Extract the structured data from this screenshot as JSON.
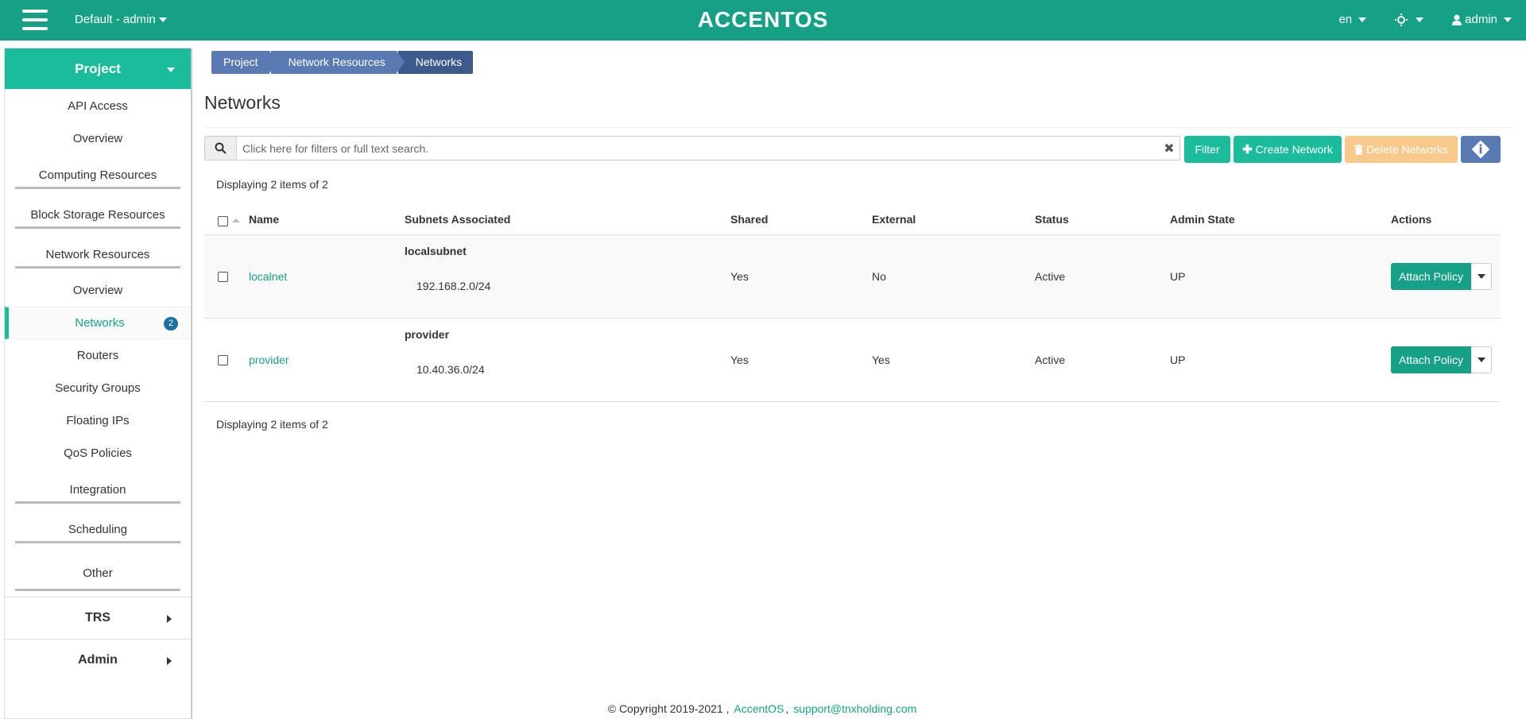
{
  "header": {
    "project_selector": "Default - admin",
    "logo": "ACCENTOS",
    "language": "en",
    "user": "admin"
  },
  "sidebar": {
    "project_label": "Project",
    "items": {
      "api_access": "API Access",
      "overview": "Overview",
      "computing": "Computing Resources",
      "block_storage": "Block Storage Resources",
      "network_resources": "Network Resources",
      "net_overview": "Overview",
      "networks": "Networks",
      "networks_badge": "2",
      "routers": "Routers",
      "security_groups": "Security Groups",
      "floating_ips": "Floating IPs",
      "qos": "QoS Policies",
      "integration": "Integration",
      "scheduling": "Scheduling",
      "other": "Other"
    },
    "trs_label": "TRS",
    "admin_label": "Admin"
  },
  "breadcrumb": [
    "Project",
    "Network Resources",
    "Networks"
  ],
  "page_title": "Networks",
  "search": {
    "placeholder": "Click here for filters or full text search."
  },
  "toolbar": {
    "filter_label": "Filter",
    "create_label": "Create Network",
    "delete_label": "Delete Networks"
  },
  "count_text": "Displaying 2 items of 2",
  "table": {
    "headers": {
      "name": "Name",
      "subnets": "Subnets Associated",
      "shared": "Shared",
      "external": "External",
      "status": "Status",
      "admin_state": "Admin State",
      "actions": "Actions"
    },
    "rows": [
      {
        "name": "localnet",
        "subnet_name": "localsubnet",
        "subnet_cidr": "192.168.2.0/24",
        "shared": "Yes",
        "external": "No",
        "status": "Active",
        "admin_state": "UP",
        "action": "Attach Policy"
      },
      {
        "name": "provider",
        "subnet_name": "provider",
        "subnet_cidr": "10.40.36.0/24",
        "shared": "Yes",
        "external": "Yes",
        "status": "Active",
        "admin_state": "UP",
        "action": "Attach Policy"
      }
    ]
  },
  "footer": {
    "copyright": "© Copyright 2019-2021 ,",
    "brand": "AccentOS",
    "separator": ",",
    "email": "support@tnxholding.com"
  },
  "colors": {
    "primary": "#16a085",
    "accent": "#1abc9c",
    "breadcrumb": "#5a7ab3",
    "breadcrumb_active": "#3d5a8c",
    "badge": "#1a6fa3",
    "delete_disabled": "#f8c98a"
  }
}
